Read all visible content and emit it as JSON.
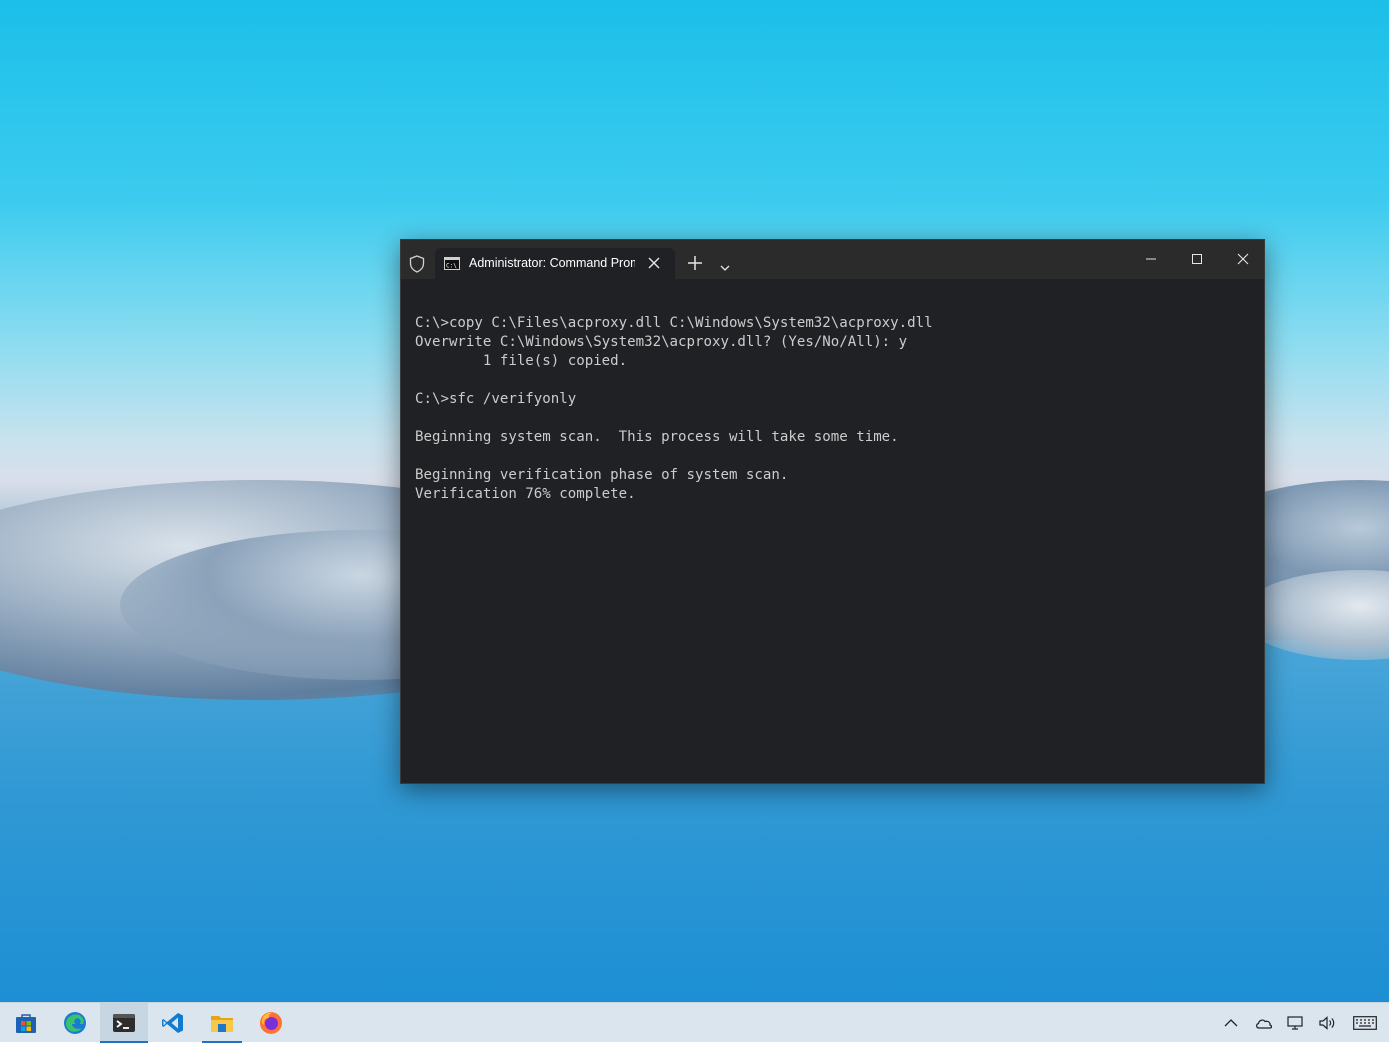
{
  "terminal": {
    "tab_title": "Administrator: Command Prompt",
    "console_lines": [
      "C:\\>copy C:\\Files\\acproxy.dll C:\\Windows\\System32\\acproxy.dll",
      "Overwrite C:\\Windows\\System32\\acproxy.dll? (Yes/No/All): y",
      "        1 file(s) copied.",
      "",
      "C:\\>sfc /verifyonly",
      "",
      "Beginning system scan.  This process will take some time.",
      "",
      "Beginning verification phase of system scan.",
      "Verification 76% complete."
    ]
  },
  "titlebar_icons": {
    "shield": "shield-icon",
    "tab": "cmd-icon",
    "close_tab": "close-icon",
    "new_tab": "plus-icon",
    "dropdown": "chevron-down-icon",
    "minimize": "minimize-icon",
    "maximize": "maximize-icon",
    "close_window": "close-icon"
  },
  "taskbar": {
    "apps": [
      {
        "name": "microsoft-store",
        "icon": "store-icon",
        "active": false
      },
      {
        "name": "edge",
        "icon": "edge-icon",
        "active": false
      },
      {
        "name": "windows-terminal",
        "icon": "terminal-icon",
        "active": true
      },
      {
        "name": "visual-studio-code",
        "icon": "vscode-icon",
        "active": false
      },
      {
        "name": "file-explorer",
        "icon": "folder-icon",
        "active": false,
        "running": true
      },
      {
        "name": "firefox",
        "icon": "firefox-icon",
        "active": false
      }
    ],
    "tray": [
      "chevron-up-icon",
      "onedrive-icon",
      "network-icon",
      "volume-icon",
      "keyboard-icon"
    ]
  },
  "colors": {
    "terminal_bg": "#202124",
    "titlebar_bg": "#2b2b2b",
    "console_text": "#cccccc",
    "taskbar_bg": "#dbe5ed",
    "accent": "#1e73c6"
  }
}
